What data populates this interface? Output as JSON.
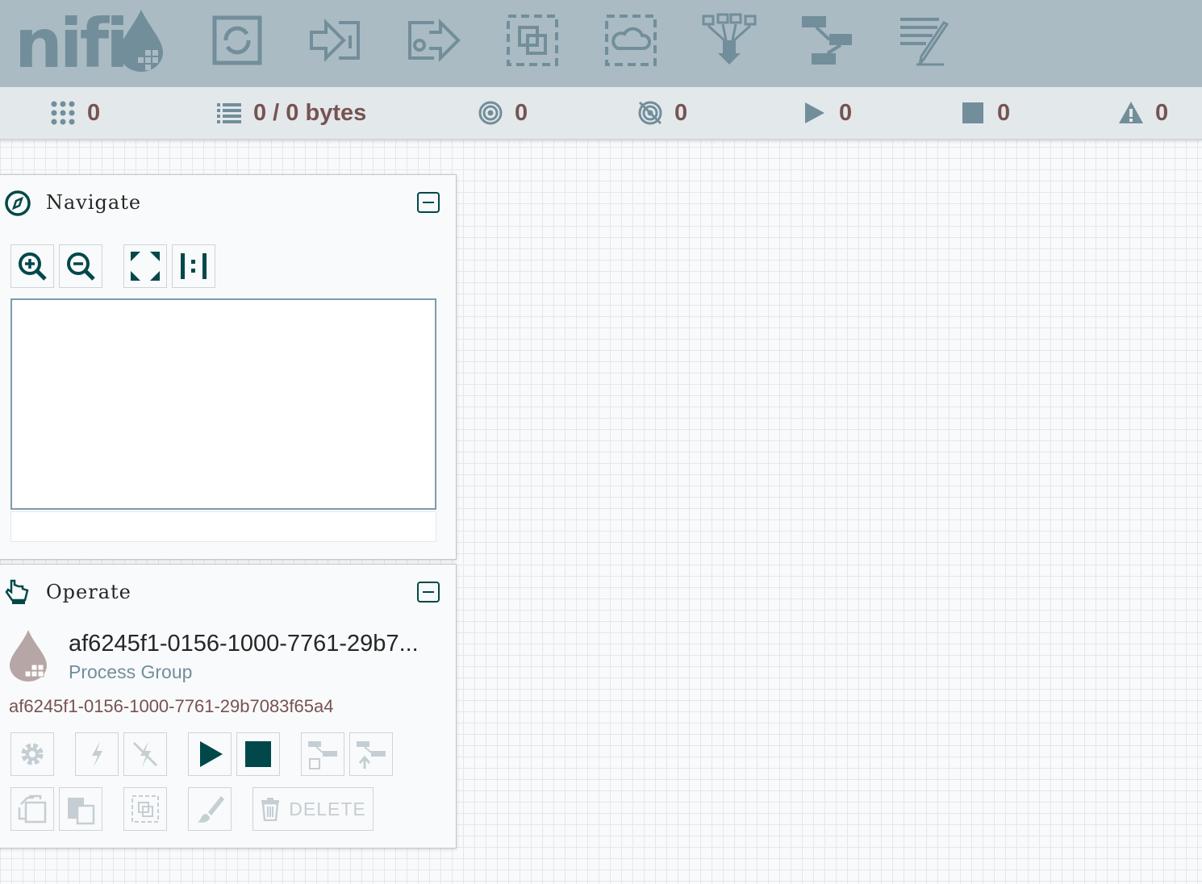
{
  "header": {
    "logo_text": "nifi",
    "tools": [
      {
        "name": "processor-icon"
      },
      {
        "name": "input-port-icon"
      },
      {
        "name": "output-port-icon"
      },
      {
        "name": "process-group-icon"
      },
      {
        "name": "remote-process-group-icon"
      },
      {
        "name": "funnel-icon"
      },
      {
        "name": "template-icon"
      },
      {
        "name": "label-icon"
      }
    ]
  },
  "stats": {
    "active_threads": "0",
    "queued": "0 / 0 bytes",
    "transmitting": "0",
    "not_transmitting": "0",
    "running": "0",
    "stopped": "0",
    "invalid": "0"
  },
  "navigate": {
    "title": "Navigate"
  },
  "operate": {
    "title": "Operate",
    "component_name": "af6245f1-0156-1000-7761-29b7...",
    "component_type": "Process Group",
    "component_id": "af6245f1-0156-1000-7761-29b7083f65a4",
    "delete_label": "DELETE"
  },
  "colors": {
    "header_bg": "#aabbc3",
    "icon_light": "#728e9b",
    "accent": "#004849",
    "value_text": "#775351"
  }
}
